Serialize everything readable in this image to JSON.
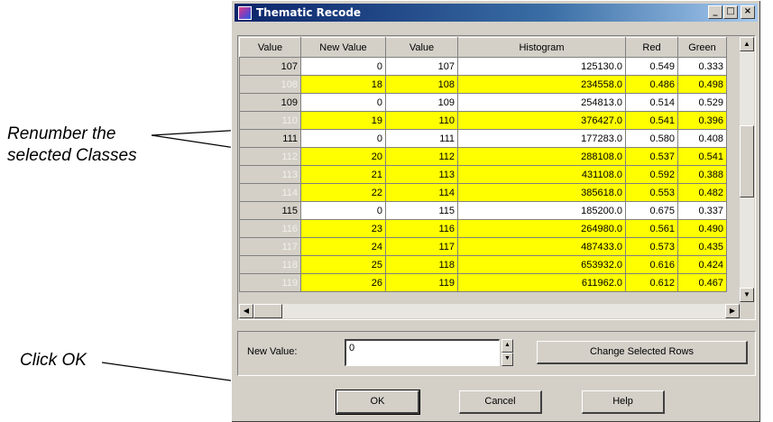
{
  "annotations": {
    "renumber_line1": "Renumber the",
    "renumber_line2": "selected Classes",
    "click_ok": "Click OK"
  },
  "window": {
    "title": "Thematic Recode",
    "min_glyph": "_",
    "max_glyph": "□",
    "close_glyph": "×"
  },
  "grid": {
    "columns": [
      "Value",
      "New Value",
      "Value",
      "Histogram",
      "Red",
      "Green"
    ],
    "rows": [
      {
        "row": "107",
        "new": "0",
        "value": "107",
        "hist": "125130.0",
        "red": "0.549",
        "green": "0.333",
        "selected": false
      },
      {
        "row": "108",
        "new": "18",
        "value": "108",
        "hist": "234558.0",
        "red": "0.486",
        "green": "0.498",
        "selected": true
      },
      {
        "row": "109",
        "new": "0",
        "value": "109",
        "hist": "254813.0",
        "red": "0.514",
        "green": "0.529",
        "selected": false
      },
      {
        "row": "110",
        "new": "19",
        "value": "110",
        "hist": "376427.0",
        "red": "0.541",
        "green": "0.396",
        "selected": true
      },
      {
        "row": "111",
        "new": "0",
        "value": "111",
        "hist": "177283.0",
        "red": "0.580",
        "green": "0.408",
        "selected": false
      },
      {
        "row": "112",
        "new": "20",
        "value": "112",
        "hist": "288108.0",
        "red": "0.537",
        "green": "0.541",
        "selected": true
      },
      {
        "row": "113",
        "new": "21",
        "value": "113",
        "hist": "431108.0",
        "red": "0.592",
        "green": "0.388",
        "selected": true
      },
      {
        "row": "114",
        "new": "22",
        "value": "114",
        "hist": "385618.0",
        "red": "0.553",
        "green": "0.482",
        "selected": true
      },
      {
        "row": "115",
        "new": "0",
        "value": "115",
        "hist": "185200.0",
        "red": "0.675",
        "green": "0.337",
        "selected": false
      },
      {
        "row": "116",
        "new": "23",
        "value": "116",
        "hist": "264980.0",
        "red": "0.561",
        "green": "0.490",
        "selected": true
      },
      {
        "row": "117",
        "new": "24",
        "value": "117",
        "hist": "487433.0",
        "red": "0.573",
        "green": "0.435",
        "selected": true
      },
      {
        "row": "118",
        "new": "25",
        "value": "118",
        "hist": "653932.0",
        "red": "0.616",
        "green": "0.424",
        "selected": true
      },
      {
        "row": "119",
        "new": "26",
        "value": "119",
        "hist": "611962.0",
        "red": "0.612",
        "green": "0.467",
        "selected": true
      }
    ]
  },
  "form": {
    "new_value_label": "New Value:",
    "new_value": "0",
    "change_button": "Change Selected Rows"
  },
  "buttons": {
    "ok": "OK",
    "cancel": "Cancel",
    "help": "Help"
  },
  "colors": {
    "selected_row": "#ffff00",
    "titlebar": "#0a246a"
  }
}
